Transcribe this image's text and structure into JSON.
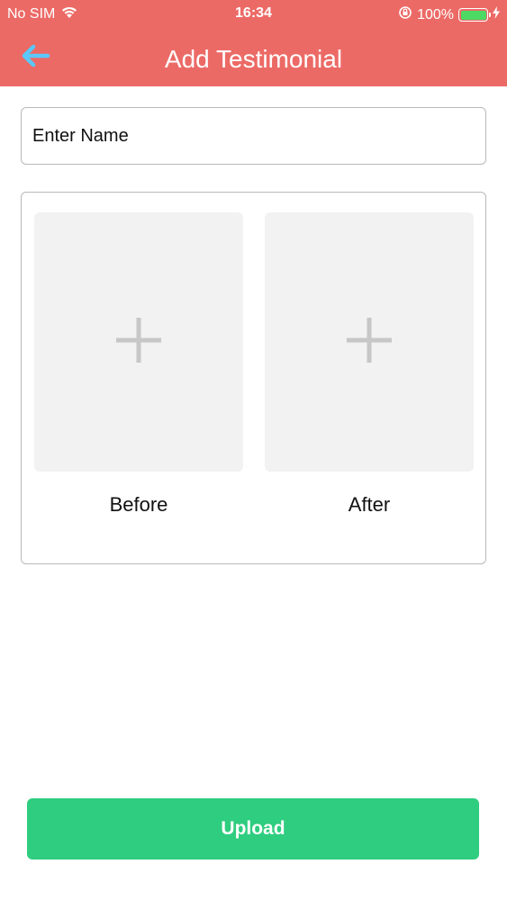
{
  "status_bar": {
    "carrier": "No SIM",
    "time": "16:34",
    "battery_percent": "100%",
    "battery_level": 1.0
  },
  "nav": {
    "title": "Add Testimonial",
    "back_icon": "back-arrow-icon"
  },
  "form": {
    "name_placeholder": "Enter Name"
  },
  "photos": {
    "before_label": "Before",
    "after_label": "After",
    "add_icon": "plus-icon"
  },
  "actions": {
    "upload_label": "Upload"
  },
  "colors": {
    "header_bg": "#ec6a66",
    "back_arrow": "#5ac8fa",
    "upload_bg": "#2ecd7f",
    "slot_bg": "#f2f2f2",
    "battery_fill": "#4cd964"
  }
}
